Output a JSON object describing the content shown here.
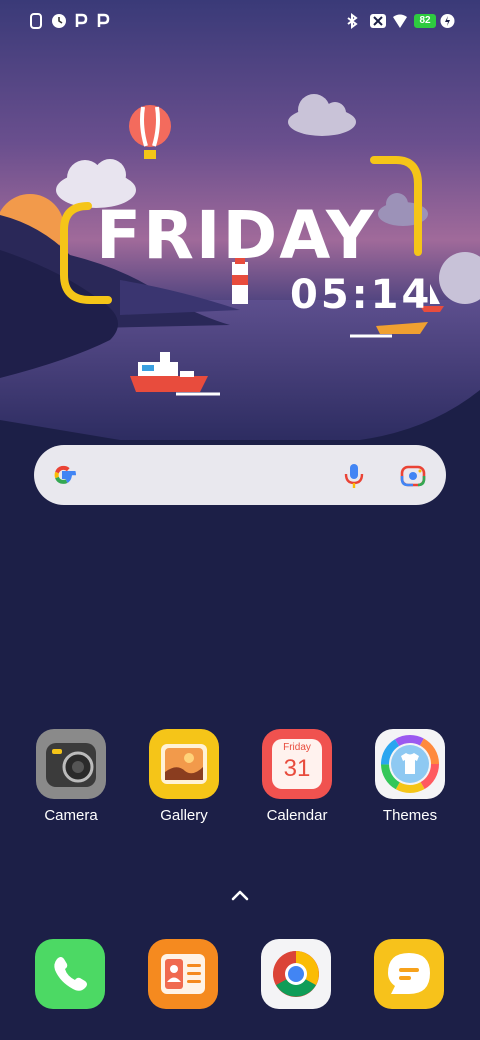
{
  "status_bar": {
    "left_icons": [
      "phone-icon",
      "clock-icon",
      "p-app-icon",
      "p-app-icon"
    ],
    "right_icons": [
      "bluetooth-icon",
      "sim-off-icon",
      "wifi-icon",
      "battery-icon",
      "charging-icon"
    ],
    "battery_level": "82"
  },
  "clock_widget": {
    "day": "FRIDAY",
    "time": "05:14"
  },
  "search_bar": {
    "icons": [
      "google-g-icon",
      "mic-icon",
      "lens-camera-icon"
    ]
  },
  "apps": [
    {
      "label": "Camera"
    },
    {
      "label": "Gallery"
    },
    {
      "label": "Calendar",
      "day_name": "Friday",
      "date": "31"
    },
    {
      "label": "Themes"
    }
  ],
  "dock": [
    "phone-icon",
    "contacts-icon",
    "chrome-icon",
    "messages-icon"
  ],
  "colors": {
    "background": "#1c1f47",
    "accent_yellow": "#f5c518",
    "battery_green": "#2ecc40"
  }
}
